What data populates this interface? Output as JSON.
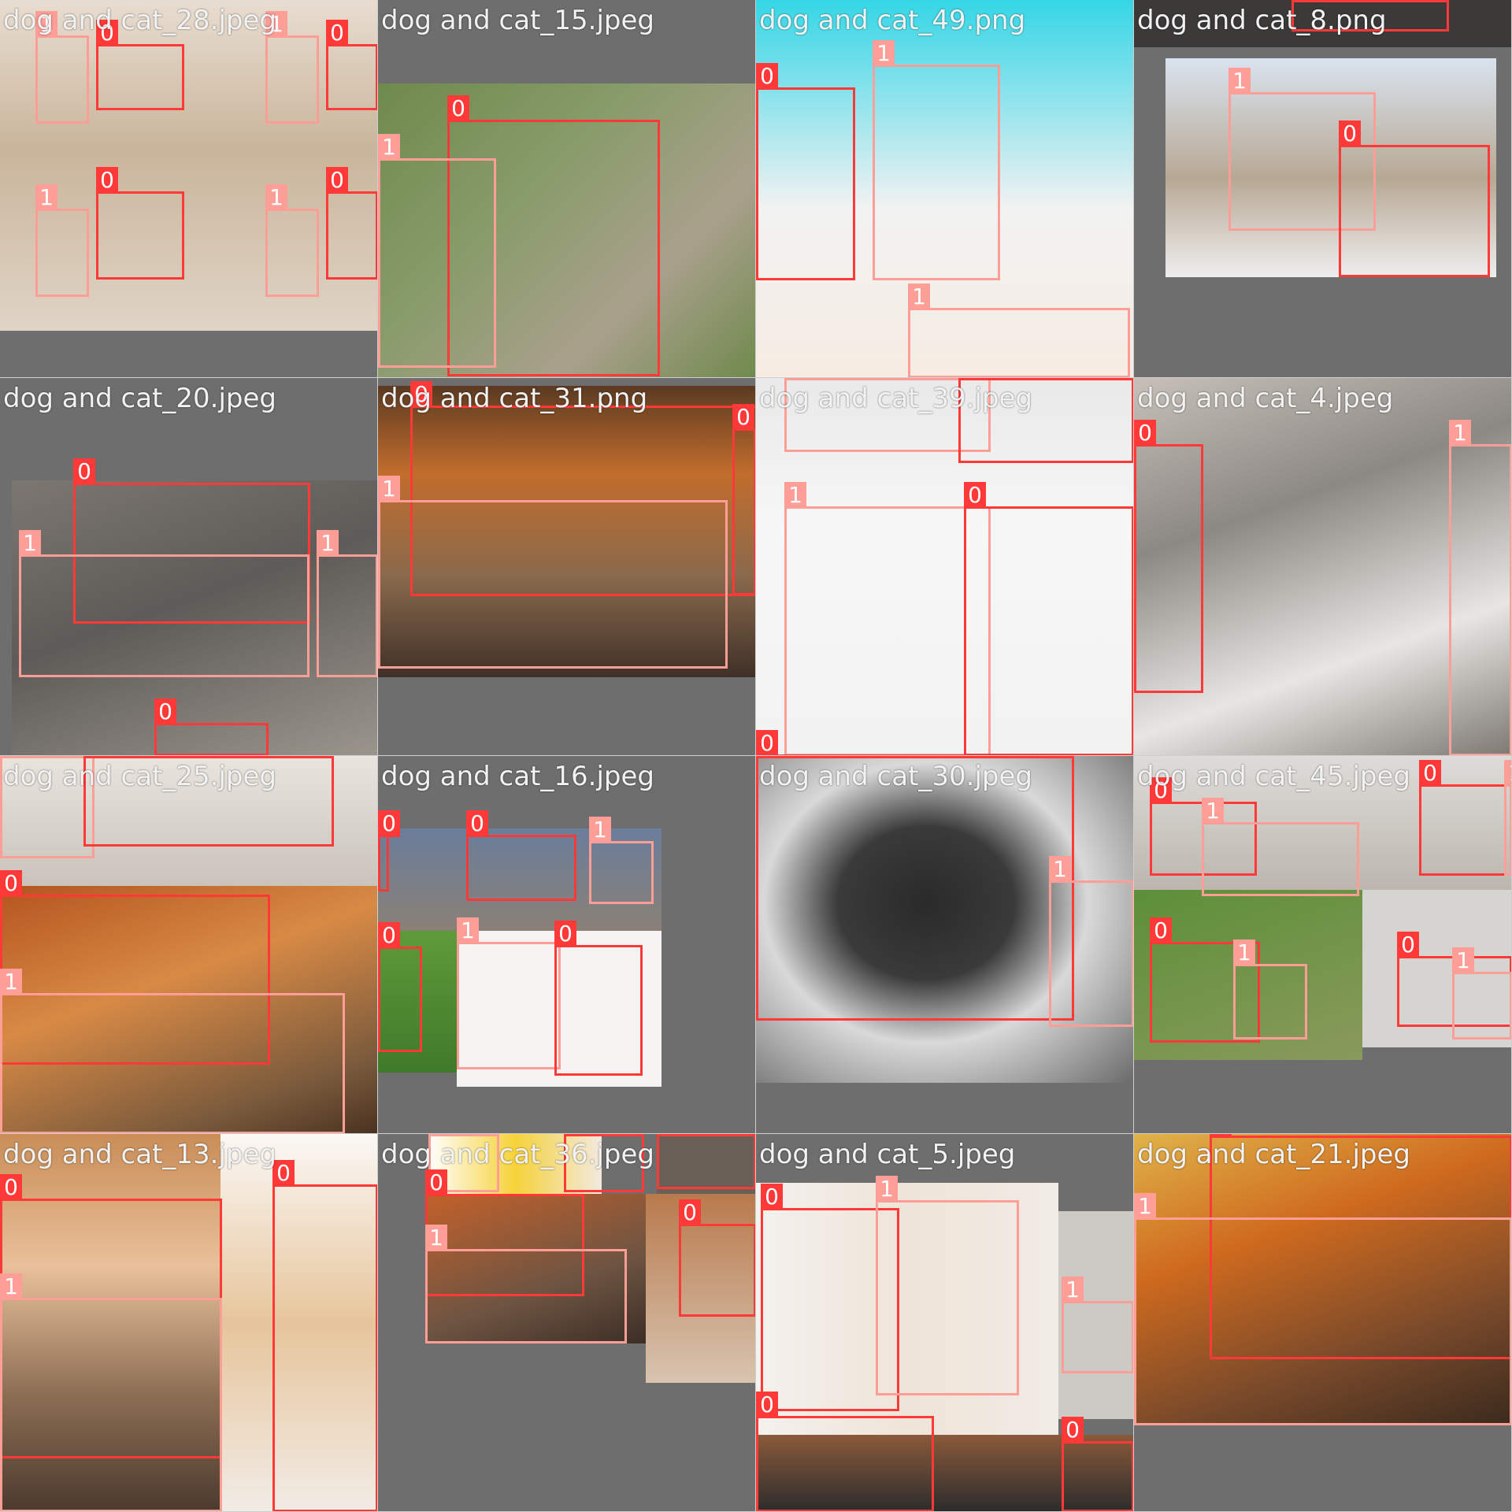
{
  "class_colors": {
    "0": "#ff3838",
    "1": "#ff9d97"
  },
  "tiles": [
    {
      "title": "dog and cat_28.jpeg",
      "labels": [
        "1",
        "0",
        "1",
        "0",
        "1",
        "0",
        "1",
        "0"
      ]
    },
    {
      "title": "dog and cat_15.jpeg",
      "labels": [
        "0",
        "1"
      ]
    },
    {
      "title": "dog and cat_49.png",
      "labels": [
        "0",
        "1",
        "1"
      ]
    },
    {
      "title": "dog and cat_8.png",
      "labels": [
        "0",
        "1",
        "0"
      ]
    },
    {
      "title": "dog and cat_20.jpeg",
      "labels": [
        "0",
        "1",
        "1",
        "0"
      ]
    },
    {
      "title": "dog and cat_31.png",
      "labels": [
        "0",
        "1",
        "0"
      ]
    },
    {
      "title": "dog and cat_39.jpeg",
      "labels": [
        "1",
        "0",
        "1",
        "0",
        "0"
      ]
    },
    {
      "title": "dog and cat_4.jpeg",
      "labels": [
        "0",
        "1"
      ]
    },
    {
      "title": "dog and cat_25.jpeg",
      "labels": [
        "1",
        "0",
        "0",
        "1"
      ]
    },
    {
      "title": "dog and cat_16.jpeg",
      "labels": [
        "0",
        "0",
        "1",
        "0",
        "1",
        "0"
      ]
    },
    {
      "title": "dog and cat_30.jpeg",
      "labels": [
        "0",
        "1"
      ]
    },
    {
      "title": "dog and cat_45.jpeg",
      "labels": [
        "0",
        "1",
        "0",
        "1",
        "0",
        "1",
        "0",
        "1"
      ]
    },
    {
      "title": "dog and cat_13.jpeg",
      "labels": [
        "0",
        "1",
        "0"
      ]
    },
    {
      "title": "dog and cat_36.jpeg",
      "labels": [
        "1",
        "0",
        "0",
        "0",
        "1",
        "0"
      ]
    },
    {
      "title": "dog and cat_5.jpeg",
      "labels": [
        "0",
        "1",
        "1",
        "0",
        "0"
      ]
    },
    {
      "title": "dog and cat_21.jpeg",
      "labels": [
        "0",
        "1"
      ]
    }
  ]
}
